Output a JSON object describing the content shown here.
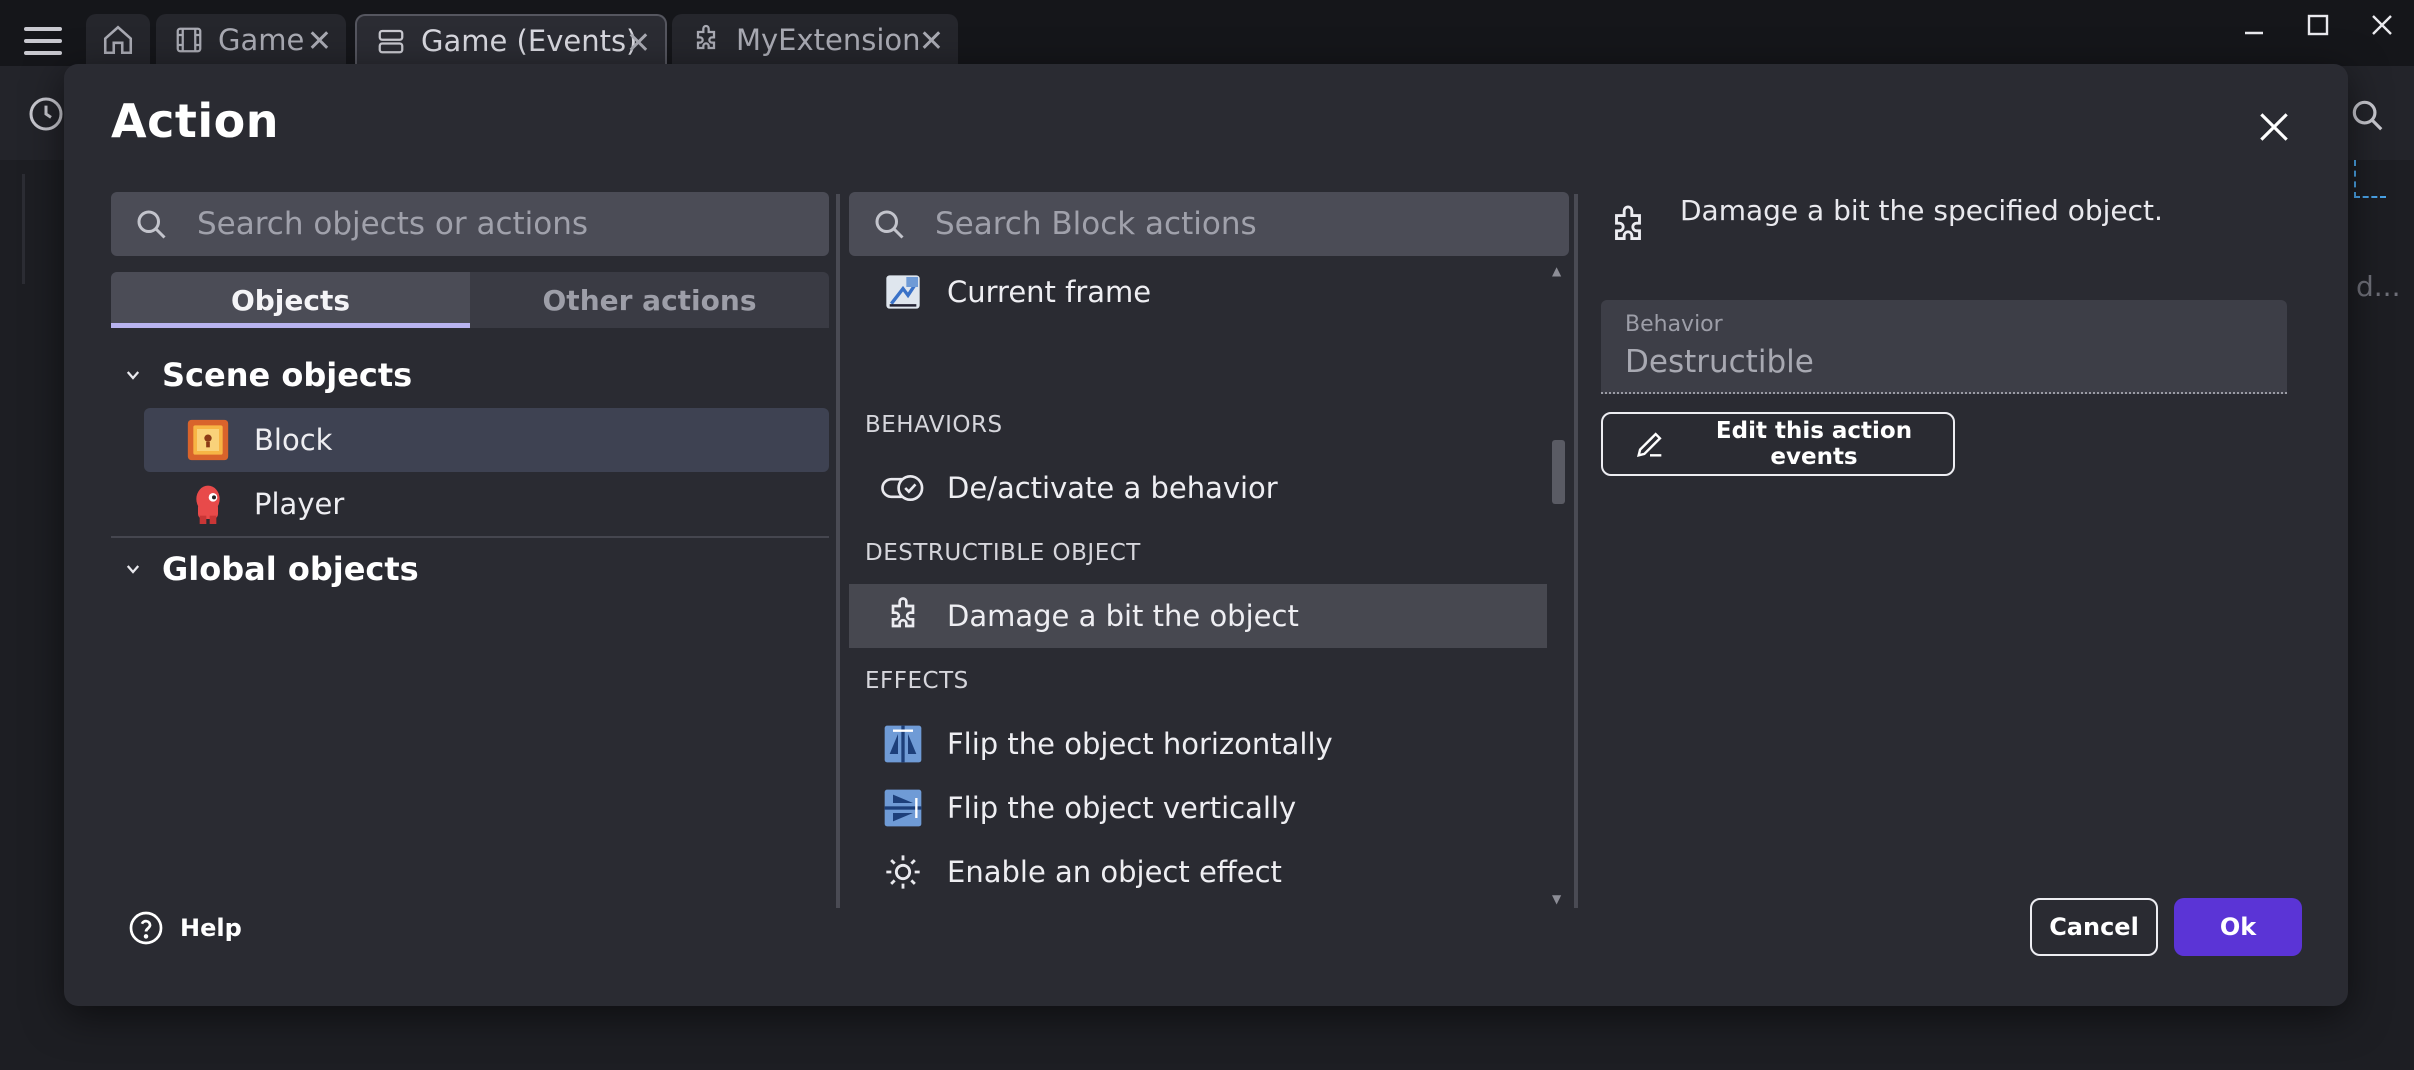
{
  "window": {
    "tabs": [
      {
        "label": "Game",
        "icon": "film-icon"
      },
      {
        "label": "Game (Events)",
        "icon": "events-icon"
      },
      {
        "label": "MyExtension",
        "icon": "puzzle-icon"
      }
    ],
    "close_glyph": "✕",
    "background_fragment": "d..."
  },
  "dialog": {
    "title": "Action",
    "left": {
      "search_placeholder": "Search objects or actions",
      "tabs": [
        "Objects",
        "Other actions"
      ],
      "groups": [
        {
          "label": "Scene objects",
          "items": [
            {
              "label": "Block",
              "icon": "block-sprite-icon",
              "selected": true
            },
            {
              "label": "Player",
              "icon": "player-sprite-icon",
              "selected": false
            }
          ]
        },
        {
          "label": "Global objects",
          "items": []
        }
      ]
    },
    "middle": {
      "search_placeholder": "Search Block actions",
      "items": [
        {
          "kind": "action",
          "label": "Current frame",
          "icon": "animation-frame-icon"
        },
        {
          "kind": "category",
          "label": "BEHAVIORS"
        },
        {
          "kind": "action",
          "label": "De/activate a behavior",
          "icon": "toggle-behavior-icon"
        },
        {
          "kind": "category",
          "label": "DESTRUCTIBLE OBJECT"
        },
        {
          "kind": "action",
          "label": "Damage a bit the object",
          "icon": "puzzle-icon",
          "selected": true
        },
        {
          "kind": "category",
          "label": "EFFECTS"
        },
        {
          "kind": "action",
          "label": "Flip the object horizontally",
          "icon": "flip-horizontal-icon"
        },
        {
          "kind": "action",
          "label": "Flip the object vertically",
          "icon": "flip-vertical-icon"
        },
        {
          "kind": "action",
          "label": "Enable an object effect",
          "icon": "sun-effect-icon"
        }
      ]
    },
    "right": {
      "description": "Damage a bit the specified object.",
      "field_label": "Behavior",
      "field_value": "Destructible",
      "edit_button": "Edit this action events"
    },
    "footer": {
      "help": "Help",
      "cancel": "Cancel",
      "ok": "Ok"
    }
  },
  "colors": {
    "accent": "#5b34d6",
    "selection": "#3e4252",
    "dialog_bg": "#2a2b32"
  }
}
